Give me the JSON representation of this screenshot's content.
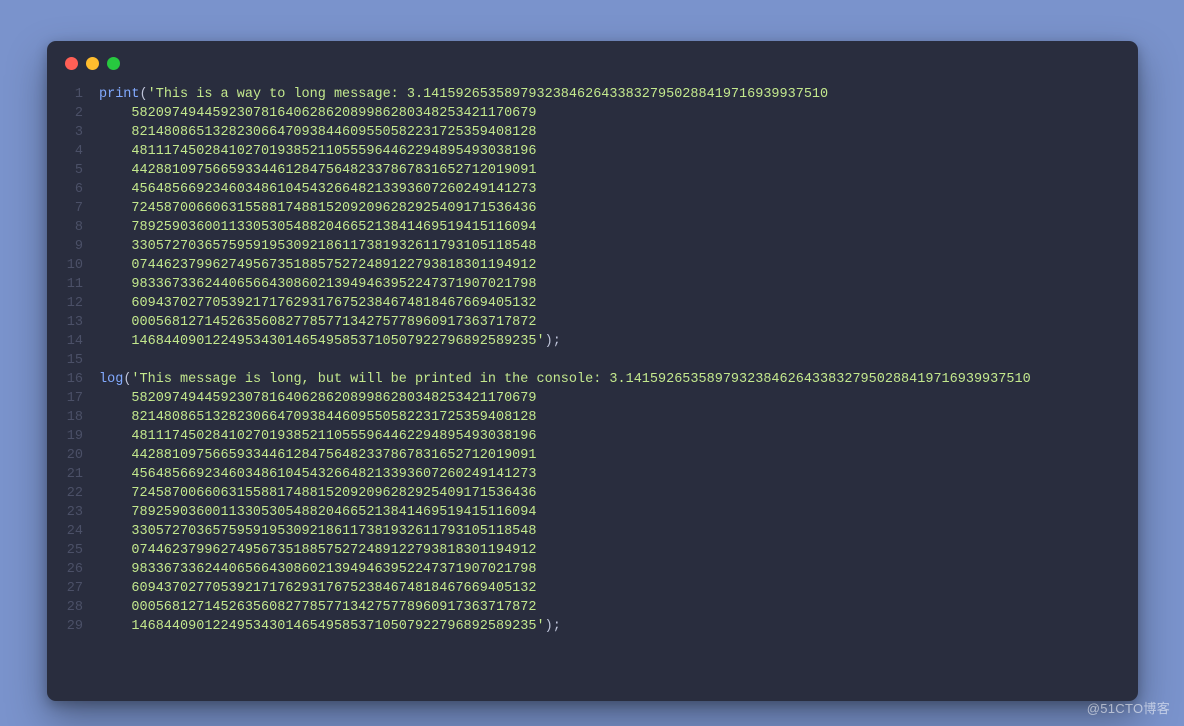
{
  "watermark": "@51CTO博客",
  "colors": {
    "background": "#7a93cc",
    "editor_bg": "#292d3e",
    "function": "#82aaff",
    "string": "#c3e88d",
    "plain": "#e0e0da",
    "gutter": "#4b5067"
  },
  "window": {
    "dots": [
      "red",
      "yellow",
      "green"
    ]
  },
  "code": {
    "line_count": 29,
    "statements": [
      {
        "fn": "print",
        "prefix": "'This is a way to long message: ",
        "first_number_segment": "3.14159265358979323846264338327950288419716939937510",
        "continuation_lines": [
          "58209749445923078164062862089986280348253421170679",
          "82148086513282306647093844609550582231725359408128",
          "48111745028410270193852110555964462294895493038196",
          "44288109756659334461284756482337867831652712019091",
          "45648566923460348610454326648213393607260249141273",
          "72458700660631558817488152092096282925409171536436",
          "78925903600113305305488204665213841469519415116094",
          "33057270365759591953092186117381932611793105118548",
          "07446237996274956735188575272489122793818301194912",
          "98336733624406566430860213949463952247371907021798",
          "60943702770539217176293176752384674818467669405132",
          "00056812714526356082778577134275778960917363717872",
          "14684409012249534301465495853710507922796892589235"
        ],
        "suffix": "');"
      },
      {
        "fn": "log",
        "prefix": "'This message is long, but will be printed in the console: ",
        "first_number_segment": "3.14159265358979323846264338327950288419716939937510",
        "continuation_lines": [
          "58209749445923078164062862089986280348253421170679",
          "82148086513282306647093844609550582231725359408128",
          "48111745028410270193852110555964462294895493038196",
          "44288109756659334461284756482337867831652712019091",
          "45648566923460348610454326648213393607260249141273",
          "72458700660631558817488152092096282925409171536436",
          "78925903600113305305488204665213841469519415116094",
          "33057270365759591953092186117381932611793105118548",
          "07446237996274956735188575272489122793818301194912",
          "98336733624406566430860213949463952247371907021798",
          "60943702770539217176293176752384674818467669405132",
          "00056812714526356082778577134275778960917363717872",
          "14684409012249534301465495853710507922796892589235"
        ],
        "suffix": "');"
      }
    ]
  }
}
